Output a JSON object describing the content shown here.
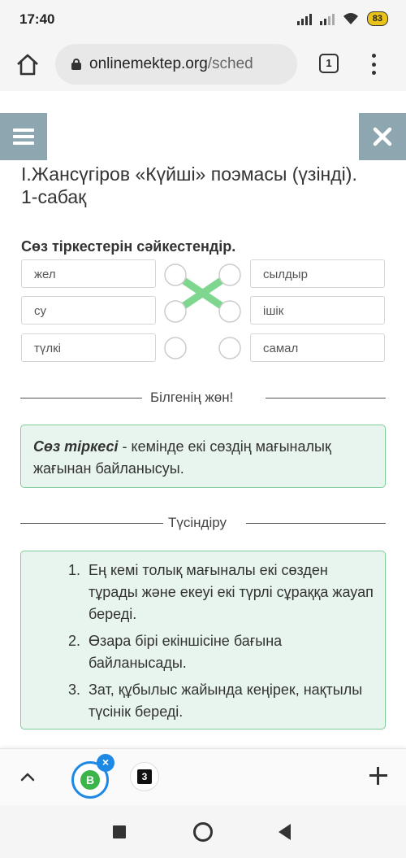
{
  "status_bar": {
    "time": "17:40",
    "battery": "83"
  },
  "browser": {
    "url_domain": "onlinemektep.org",
    "url_path": "/sched",
    "tab_count": "1"
  },
  "page": {
    "title": "І.Жансүгіров «Күйші» поэмасы (үзінді). 1-сабақ",
    "task": "Сөз тіркестерін сәйкестендір.",
    "matching": {
      "left_words": [
        "жел",
        "су",
        "түлкі"
      ],
      "right_words": [
        "сылдыр",
        "ішік",
        "самал"
      ],
      "connections": [
        [
          0,
          1
        ],
        [
          1,
          0
        ]
      ]
    },
    "section1_label": "Білгенің жөн!",
    "definition_term": "Сөз тіркесі",
    "definition_rest": " - кемінде екі сөздің мағыналық жағынан байланысуы.",
    "section2_label": "Түсіндіру",
    "explanation_items": [
      {
        "num": "1.",
        "text": "Ең кемі толық мағыналы екі сөзден тұрады және екеуі екі түрлі сұраққа жауап береді."
      },
      {
        "num": "2.",
        "text": "Өзара бірі екіншісіне бағына байланысады."
      },
      {
        "num": "3.",
        "text": "Зат, құбылыс жайында кеңірек, нақтылы түсінік береді."
      }
    ]
  },
  "tabbar": {
    "tab1_letter": "B",
    "tab1_badge": "×",
    "tab2_letter": "3"
  },
  "colors": {
    "accent_green": "#7fcc9c",
    "box_bg": "#e8f5ee",
    "connector": "#7ed68f",
    "menu_button": "#8ea6b0"
  }
}
